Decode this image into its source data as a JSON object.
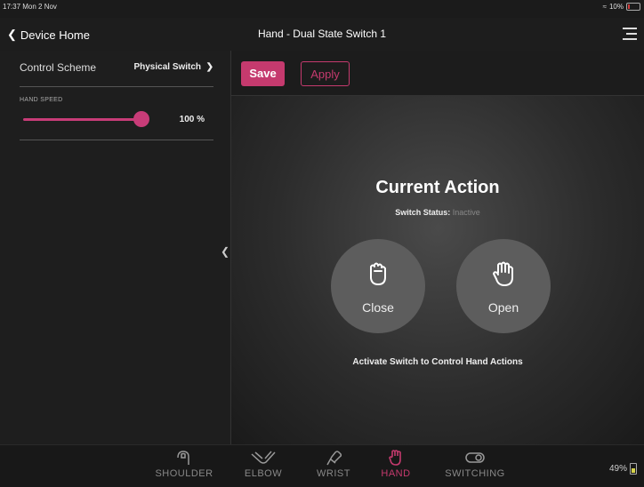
{
  "status_bar": {
    "time": "17:37  Mon 2 Nov",
    "battery": "10%"
  },
  "nav": {
    "back_label": "Device Home",
    "title": "Hand - Dual State Switch 1"
  },
  "sidebar": {
    "control_scheme_label": "Control Scheme",
    "control_scheme_value": "Physical Switch",
    "hand_speed_label": "HAND SPEED",
    "hand_speed_value": "100 %",
    "hand_speed_level": 1.0
  },
  "toolbar": {
    "save_label": "Save",
    "apply_label": "Apply"
  },
  "main": {
    "title": "Current Action",
    "status_label": "Switch Status:",
    "status_value": "Inactive",
    "actions": [
      {
        "label": "Close"
      },
      {
        "label": "Open"
      }
    ],
    "hint": "Activate Switch to Control Hand Actions"
  },
  "tabs": [
    {
      "label": "SHOULDER",
      "icon": "shoulder-icon"
    },
    {
      "label": "ELBOW",
      "icon": "elbow-icon"
    },
    {
      "label": "WRIST",
      "icon": "wrist-icon"
    },
    {
      "label": "HAND",
      "icon": "hand-icon"
    },
    {
      "label": "SWITCHING",
      "icon": "switch-icon"
    }
  ],
  "device_battery": "49%",
  "colors": {
    "accent": "#c53a6e",
    "background": "#1b1b1b"
  }
}
